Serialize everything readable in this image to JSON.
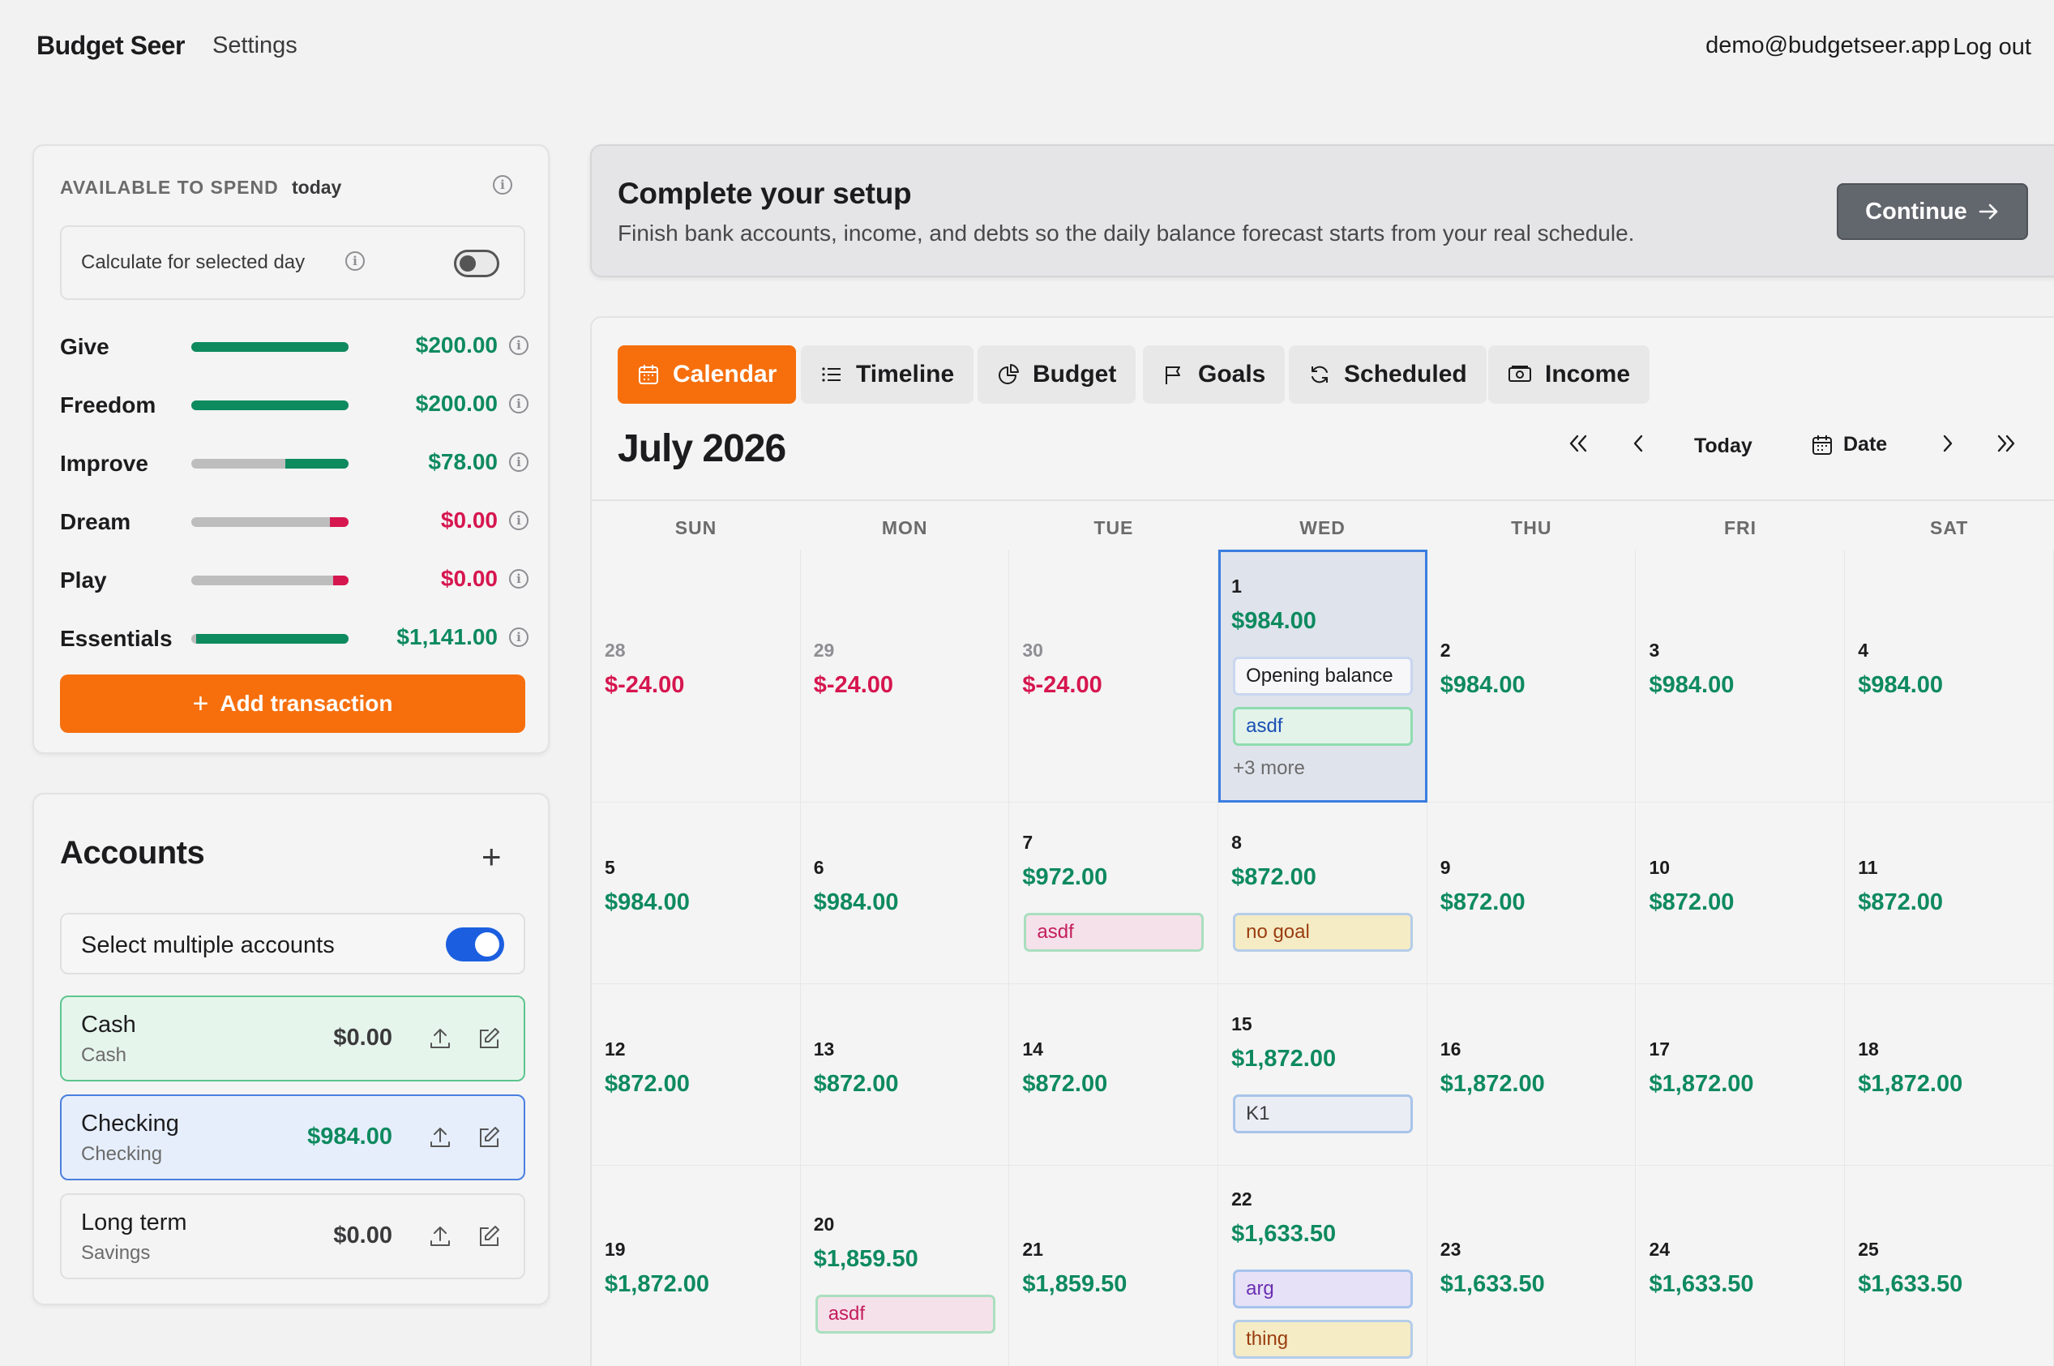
{
  "header": {
    "app_name": "Budget Seer",
    "nav_settings": "Settings",
    "user_email": "demo@budgetseer.app",
    "logout": "Log out"
  },
  "spend": {
    "title": "AVAILABLE TO SPEND",
    "title_suffix": "today",
    "calc_label": "Calculate for selected day",
    "calc_toggle_on": false,
    "categories": [
      {
        "name": "Give",
        "amount": "$200.00",
        "color": "green",
        "fill": 1.0
      },
      {
        "name": "Freedom",
        "amount": "$200.00",
        "color": "green",
        "fill": 1.0
      },
      {
        "name": "Improve",
        "amount": "$78.00",
        "color": "green",
        "fill": 0.4
      },
      {
        "name": "Dream",
        "amount": "$0.00",
        "color": "red",
        "fill": 0.12
      },
      {
        "name": "Play",
        "amount": "$0.00",
        "color": "red",
        "fill": 0.1
      },
      {
        "name": "Essentials",
        "amount": "$1,141.00",
        "color": "green",
        "fill": 0.97
      }
    ],
    "add_transaction": "Add transaction"
  },
  "accounts": {
    "title": "Accounts",
    "multi_label": "Select multiple accounts",
    "multi_toggle_on": true,
    "items": [
      {
        "name": "Cash",
        "type": "Cash",
        "balance": "$0.00"
      },
      {
        "name": "Checking",
        "type": "Checking",
        "balance": "$984.00"
      },
      {
        "name": "Long term",
        "type": "Savings",
        "balance": "$0.00"
      }
    ]
  },
  "setup": {
    "title": "Complete your setup",
    "text": "Finish bank accounts, income, and debts so the daily balance forecast starts from your real schedule.",
    "continue": "Continue"
  },
  "tabs": [
    {
      "label": "Calendar",
      "icon": "calendar-icon",
      "active": true
    },
    {
      "label": "Timeline",
      "icon": "list-icon"
    },
    {
      "label": "Budget",
      "icon": "pie-chart-icon"
    },
    {
      "label": "Goals",
      "icon": "flag-icon"
    },
    {
      "label": "Scheduled",
      "icon": "refresh-icon"
    },
    {
      "label": "Income",
      "icon": "money-icon"
    }
  ],
  "calendar": {
    "month": "July 2026",
    "today_label": "Today",
    "date_label": "Date",
    "weekdays": [
      "SUN",
      "MON",
      "TUE",
      "WED",
      "THU",
      "FRI",
      "SAT"
    ],
    "weeks": [
      [
        {
          "day": "28",
          "balance": "$-24.00",
          "prev": true,
          "negative": true
        },
        {
          "day": "29",
          "balance": "$-24.00",
          "prev": true,
          "negative": true
        },
        {
          "day": "30",
          "balance": "$-24.00",
          "prev": true,
          "negative": true
        },
        {
          "day": "1",
          "balance": "$984.00",
          "selected": true,
          "events": [
            {
              "label": "Opening balance",
              "style": "white"
            },
            {
              "label": "asdf",
              "style": "green"
            }
          ],
          "more": "+3 more"
        },
        {
          "day": "2",
          "balance": "$984.00"
        },
        {
          "day": "3",
          "balance": "$984.00"
        },
        {
          "day": "4",
          "balance": "$984.00"
        }
      ],
      [
        {
          "day": "5",
          "balance": "$984.00"
        },
        {
          "day": "6",
          "balance": "$984.00"
        },
        {
          "day": "7",
          "balance": "$972.00",
          "events": [
            {
              "label": "asdf",
              "style": "pink"
            }
          ]
        },
        {
          "day": "8",
          "balance": "$872.00",
          "events": [
            {
              "label": "no goal",
              "style": "yellow"
            }
          ]
        },
        {
          "day": "9",
          "balance": "$872.00"
        },
        {
          "day": "10",
          "balance": "$872.00"
        },
        {
          "day": "11",
          "balance": "$872.00"
        }
      ],
      [
        {
          "day": "12",
          "balance": "$872.00"
        },
        {
          "day": "13",
          "balance": "$872.00"
        },
        {
          "day": "14",
          "balance": "$872.00"
        },
        {
          "day": "15",
          "balance": "$1,872.00",
          "events": [
            {
              "label": "K1",
              "style": "blue"
            }
          ]
        },
        {
          "day": "16",
          "balance": "$1,872.00"
        },
        {
          "day": "17",
          "balance": "$1,872.00"
        },
        {
          "day": "18",
          "balance": "$1,872.00"
        }
      ],
      [
        {
          "day": "19",
          "balance": "$1,872.00"
        },
        {
          "day": "20",
          "balance": "$1,859.50",
          "events": [
            {
              "label": "asdf",
              "style": "pink"
            }
          ]
        },
        {
          "day": "21",
          "balance": "$1,859.50"
        },
        {
          "day": "22",
          "balance": "$1,633.50",
          "events": [
            {
              "label": "arg",
              "style": "purple"
            },
            {
              "label": "thing",
              "style": "yellow"
            }
          ]
        },
        {
          "day": "23",
          "balance": "$1,633.50"
        },
        {
          "day": "24",
          "balance": "$1,633.50"
        },
        {
          "day": "25",
          "balance": "$1,633.50"
        }
      ]
    ]
  },
  "colors": {
    "accent": "#f66f0c",
    "positive": "#0e8a5f",
    "negative": "#d6164f",
    "selected_border": "#3b7de0",
    "toggle_on": "#1b5fe0"
  }
}
